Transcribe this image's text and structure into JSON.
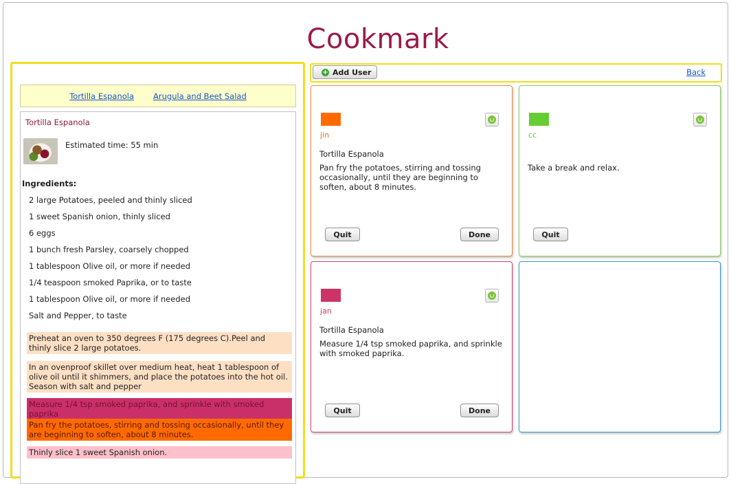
{
  "app": {
    "title": "Cookmark"
  },
  "recipe_tabs": [
    "Tortilla Espanola",
    "Arugula and Beet Salad"
  ],
  "recipe": {
    "title": "Tortilla Espanola",
    "estimated_time": "Estimated time: 55 min",
    "ingredients_heading": "Ingredients:",
    "ingredients": [
      "2 large Potatoes, peeled and thinly sliced",
      "1 sweet Spanish onion, thinly sliced",
      "6 eggs",
      "1 bunch fresh Parsley, coarsely chopped",
      "1 tablespoon Olive oil, or more if needed",
      "1/4 teaspoon smoked Paprika, or to taste",
      "1 tablespoon Olive oil, or more if needed",
      "Salt and Pepper, to taste"
    ],
    "steps": [
      {
        "text": "Preheat an oven to 350 degrees F (175 degrees C).Peel and thinly slice 2 large potatoes.",
        "bg": "#fde0c4",
        "color": "#222222"
      },
      {
        "text": "In an ovenproof skillet over medium heat, heat 1 tablespoon of olive oil until it shimmers, and place the potatoes into the hot oil. Season with salt and pepper",
        "bg": "#fde0c4",
        "color": "#222222"
      },
      {
        "text": "Measure 1/4 tsp smoked paprika, and sprinkle with smoked paprika",
        "bg": "#c9306a",
        "color": "#7a1030"
      },
      {
        "text": "Pan fry the potatoes, stirring and tossing occasionally, until they are beginning to soften, about 8 minutes.",
        "bg": "#ff6a00",
        "color": "#5a1a00"
      },
      {
        "text": "Thinly slice 1 sweet Spanish onion.",
        "bg": "#ffc0cb",
        "color": "#222222"
      }
    ]
  },
  "toolbar": {
    "add_user_label": "Add User",
    "back_label": "Back"
  },
  "cards": [
    {
      "user": "jin",
      "color": "#ff6a00",
      "border": "#f08a3a",
      "recipe": "Tortilla Espanola",
      "step": "Pan fry the potatoes, stirring and tossing occasionally, until they are beginning to soften, about 8 minutes.",
      "quit": "Quit",
      "done": "Done"
    },
    {
      "user": "cc",
      "color": "#66cc33",
      "border": "#88cc55",
      "recipe": "",
      "step": "Take a break and relax.",
      "quit": "Quit",
      "done": ""
    },
    {
      "user": "jan",
      "color": "#cc3366",
      "border": "#cc4477",
      "recipe": "Tortilla Espanola",
      "step": "Measure 1/4 tsp smoked paprika, and sprinkle with smoked paprika.",
      "quit": "Quit",
      "done": "Done"
    }
  ],
  "empty_card_border": "#3399cc"
}
